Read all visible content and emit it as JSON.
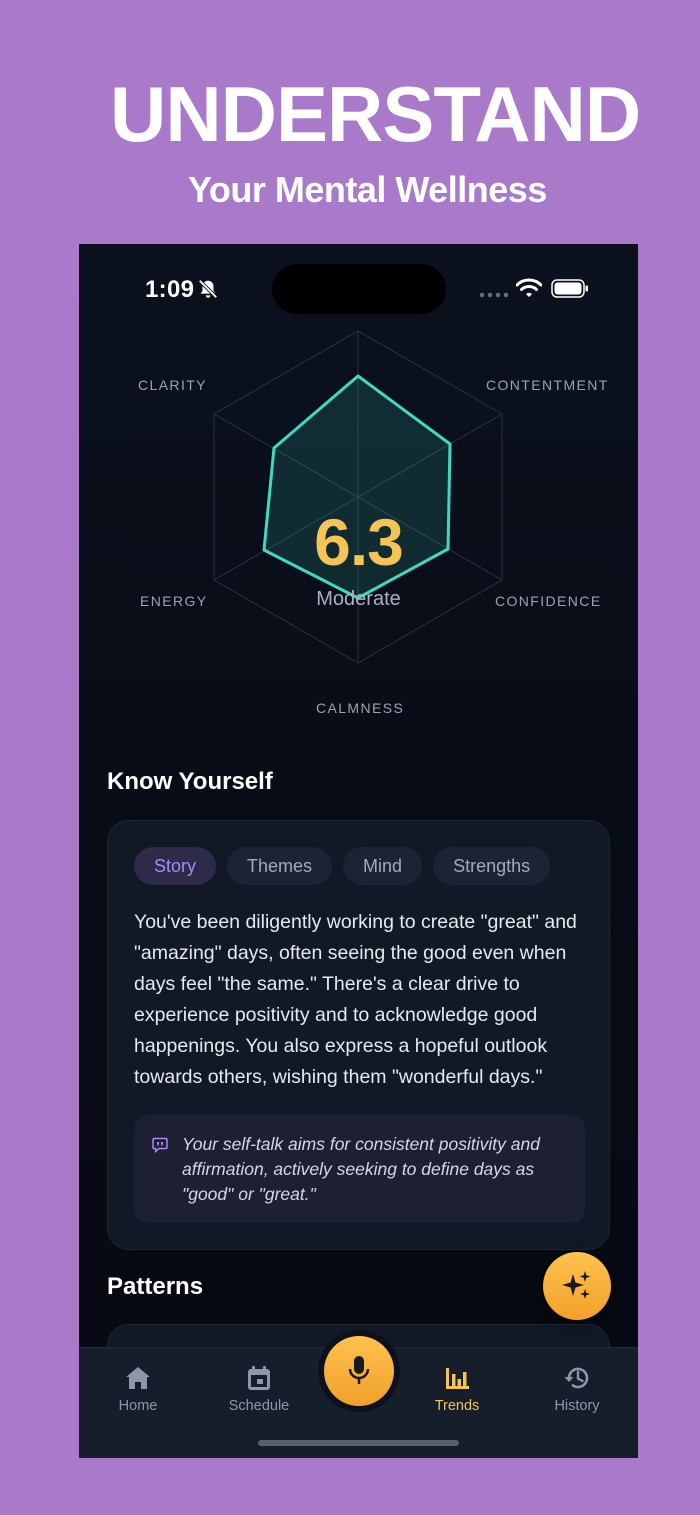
{
  "promo": {
    "headline": "UNDERSTAND",
    "subline": "Your Mental Wellness"
  },
  "status_bar": {
    "time": "1:09"
  },
  "radar": {
    "labels": {
      "clarity": "CLARITY",
      "contentment": "CONTENTMENT",
      "energy": "ENERGY",
      "confidence": "CONFIDENCE",
      "calmness": "CALMNESS"
    },
    "score": "6.3",
    "rating": "Moderate",
    "accent_color": "#3fd9c0",
    "score_color": "#f6c356"
  },
  "know_yourself": {
    "title": "Know Yourself",
    "tabs": [
      "Story",
      "Themes",
      "Mind",
      "Strengths"
    ],
    "active_tab": "Story",
    "story": "You've been diligently working to create \"great\" and \"amazing\" days, often seeing the good even when days feel \"the same.\" There's a clear drive to experience positivity and to acknowledge good happenings. You also express a hopeful outlook towards others, wishing them \"wonderful days.\"",
    "quote": "Your self-talk aims for consistent positivity and affirmation, actively seeking to define days as \"good\" or \"great.\""
  },
  "patterns": {
    "title": "Patterns"
  },
  "nav": {
    "home": "Home",
    "schedule": "Schedule",
    "trends": "Trends",
    "history": "History",
    "active": "Trends",
    "active_color": "#f6c356"
  }
}
